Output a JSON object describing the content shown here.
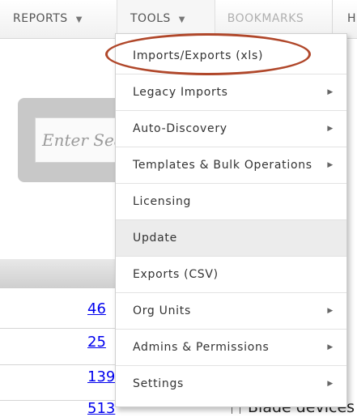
{
  "topnav": {
    "reports": "REPORTS",
    "tools": "TOOLS",
    "bookmarks": "BOOKMARKS",
    "next": "H",
    "caret_icon": "caret-down-icon"
  },
  "search": {
    "placeholder": "Enter Sea"
  },
  "counts": [
    "46",
    "25",
    "139",
    "513"
  ],
  "right_text": "Blade devices",
  "tools_menu": {
    "items": [
      {
        "label": "Imports/Exports (xls)",
        "has_submenu": false
      },
      {
        "label": "Legacy Imports",
        "has_submenu": true
      },
      {
        "label": "Auto-Discovery",
        "has_submenu": true
      },
      {
        "label": "Templates & Bulk Operations",
        "has_submenu": true
      },
      {
        "label": "Licensing",
        "has_submenu": false
      },
      {
        "label": "Update",
        "has_submenu": false,
        "highlighted": true
      },
      {
        "label": "Exports (CSV)",
        "has_submenu": false
      },
      {
        "label": "Org Units",
        "has_submenu": true
      },
      {
        "label": "Admins & Permissions",
        "has_submenu": true
      },
      {
        "label": "Settings",
        "has_submenu": true
      }
    ]
  },
  "colors": {
    "callout": "#b0472a",
    "link": "#0000ee",
    "highlight": "#ececec"
  }
}
